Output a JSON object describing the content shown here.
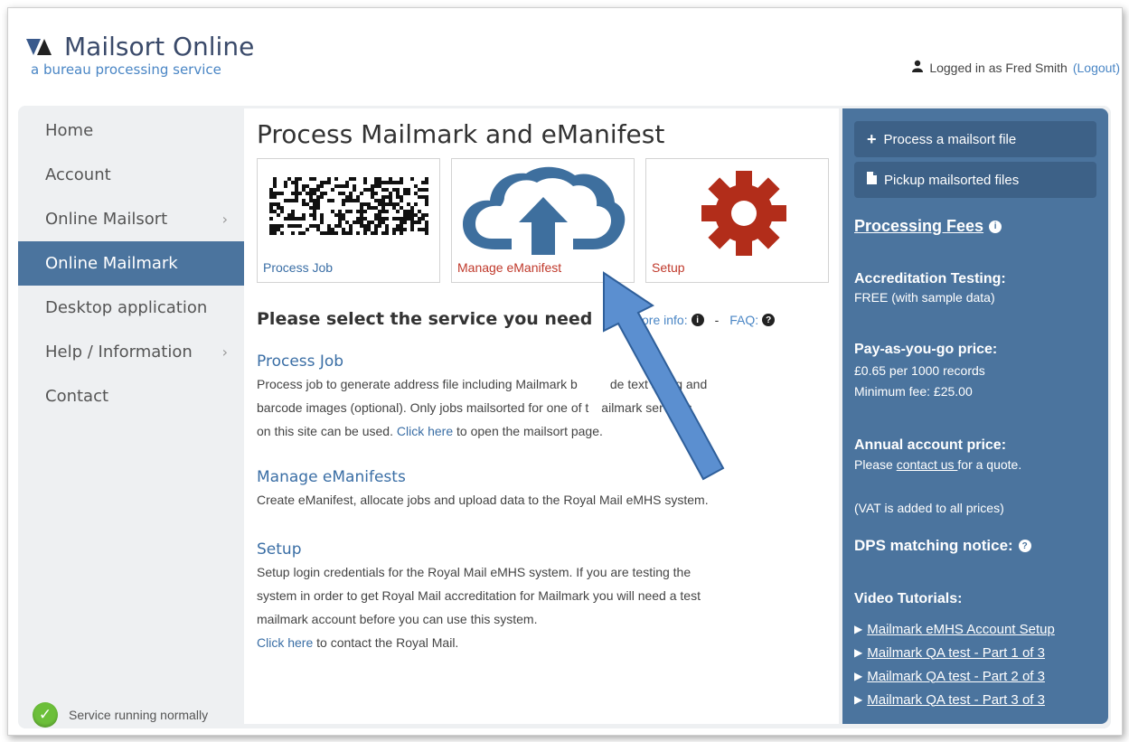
{
  "header": {
    "logo_title": "Mailsort Online",
    "logo_subtitle": "a bureau processing service",
    "login_text": "Logged in as Fred Smith",
    "logout_label": "(Logout)"
  },
  "sidebar": {
    "items": [
      {
        "label": "Home"
      },
      {
        "label": "Account"
      },
      {
        "label": "Online Mailsort"
      },
      {
        "label": "Online Mailmark"
      },
      {
        "label": "Desktop application"
      },
      {
        "label": "Help / Information"
      },
      {
        "label": "Contact"
      }
    ],
    "status_text": "Service running normally"
  },
  "main": {
    "title": "Process Mailmark and eManifest",
    "tiles": [
      {
        "label": "Process Job",
        "icon": "barcode-icon"
      },
      {
        "label": "Manage eManifest",
        "icon": "cloud-upload-icon"
      },
      {
        "label": "Setup",
        "icon": "gear-icon"
      }
    ],
    "select_heading": "Please select the service you need",
    "more_info_label": "ore info:",
    "faq_label": "FAQ:",
    "sections": [
      {
        "title": "Process Job",
        "text1": "Process job to generate address file including Mailmark b",
        "text1b": "de text string and",
        "text2": "barcode images (optional). Only jobs mailsorted for one of t",
        "text2b": "ailmark services",
        "text3a": "on this site can be used. ",
        "link": "Click here",
        "text3b": " to open the mailsort page."
      },
      {
        "title": "Manage eManifests",
        "text": "Create eManifest, allocate jobs and upload data to the Royal Mail eMHS system."
      },
      {
        "title": "Setup",
        "text1": "Setup login credentials for the Royal Mail eMHS system. If you are testing the",
        "text2": "system in order to get Royal Mail accreditation for Mailmark you will need a test",
        "text3": "mailmark account before you can use this system.",
        "link": "Click here",
        "text4": " to contact the Royal Mail."
      }
    ]
  },
  "right": {
    "btn_process": "Process a mailsort file",
    "btn_pickup": "Pickup mailsorted files",
    "fees_title": "Processing Fees ",
    "accreditation_h": "Accreditation Testing:",
    "accreditation_s": "FREE (with sample data)",
    "payg_h": "Pay-as-you-go price:",
    "payg_s1": "£0.65 per 1000 records",
    "payg_s2": "Minimum fee: £25.00",
    "annual_h": "Annual account price:",
    "annual_pre": "Please ",
    "annual_link": "contact us ",
    "annual_post": "for a quote.",
    "vat": "(VAT is added to all prices)",
    "dps": "DPS matching notice: ",
    "video_h": "Video Tutorials:",
    "videos": [
      "Mailmark eMHS Account Setup",
      "Mailmark QA test - Part 1 of 3",
      "Mailmark QA test - Part 2 of 3",
      "Mailmark QA test - Part 3 of 3"
    ]
  },
  "colors": {
    "nav_active": "#4b749e",
    "right_panel": "#4b749e",
    "link": "#3a6ea5",
    "tile_red": "#c0392b",
    "arrow": "#5b8fd0"
  }
}
